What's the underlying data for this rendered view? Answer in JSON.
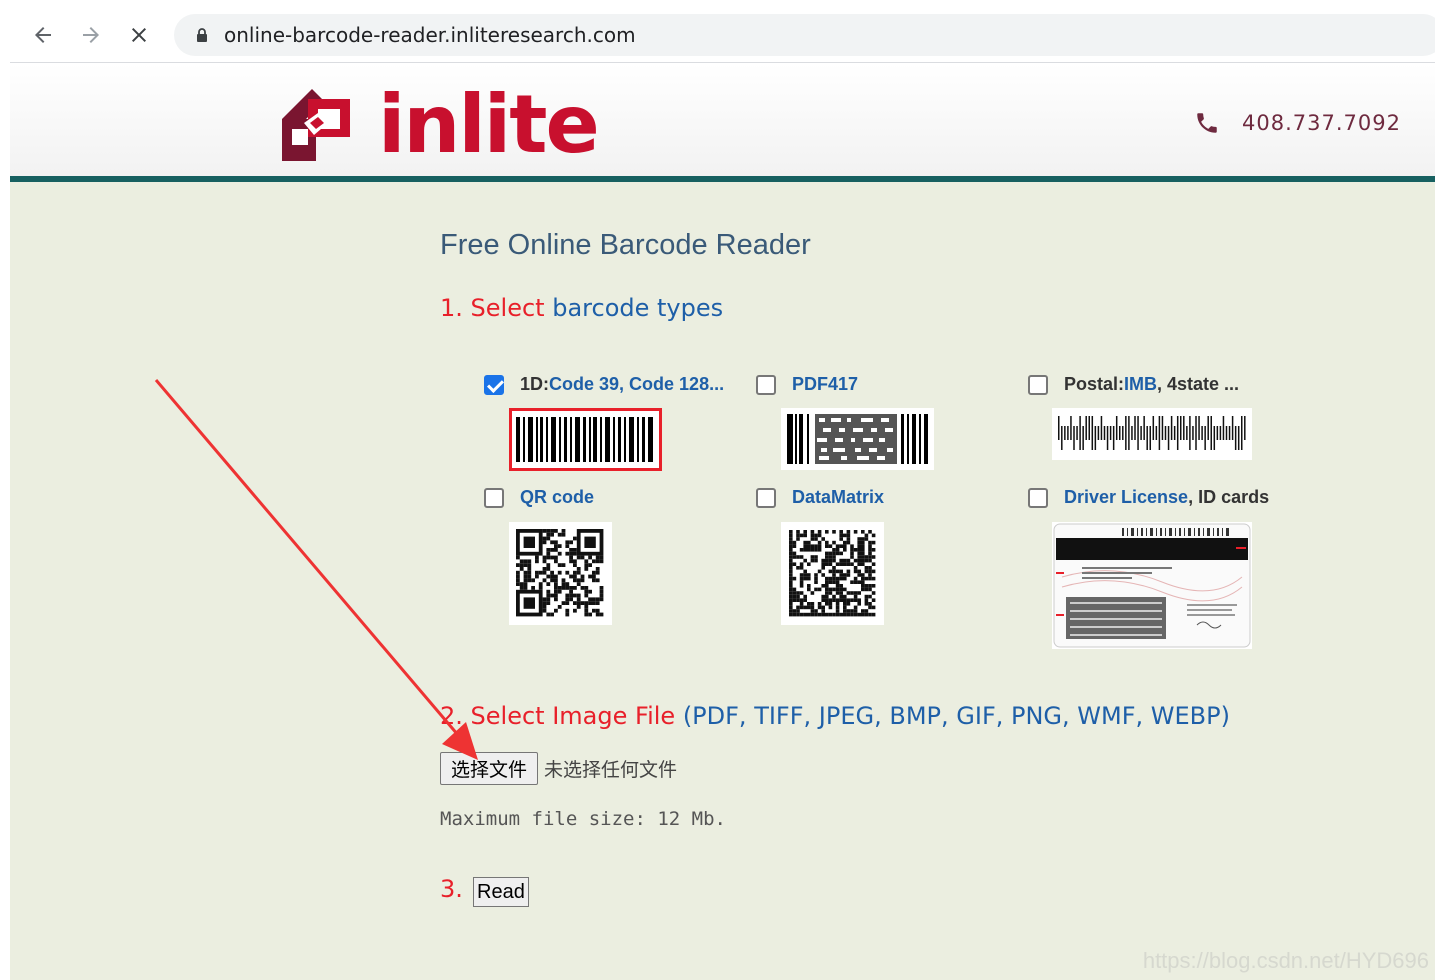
{
  "browser": {
    "url": "online-barcode-reader.inliteresearch.com",
    "back_icon": "arrow-left-icon",
    "forward_icon": "arrow-right-icon",
    "stop_icon": "close-icon"
  },
  "header": {
    "logo_text": "inlite",
    "phone": "408.737.7092"
  },
  "main": {
    "title": "Free Online Barcode Reader",
    "step1": {
      "number": "1.",
      "select": "Select",
      "rest": "barcode types"
    },
    "barcode_types": [
      {
        "checked": true,
        "prefix": "1D: ",
        "link": "Code 39, Code 128...",
        "suffix": ""
      },
      {
        "checked": false,
        "prefix": "",
        "link": "PDF417",
        "suffix": ""
      },
      {
        "checked": false,
        "prefix": "Postal: ",
        "link": "IMB",
        "suffix": ", 4state ..."
      },
      {
        "checked": false,
        "prefix": "",
        "link": "QR code",
        "suffix": ""
      },
      {
        "checked": false,
        "prefix": "",
        "link": "DataMatrix",
        "suffix": ""
      },
      {
        "checked": false,
        "prefix": "",
        "link": "Driver License",
        "suffix": ", ID cards"
      }
    ],
    "step2": {
      "number": "2.",
      "label": "Select Image File",
      "formats": "(PDF, TIFF, JPEG, BMP, GIF, PNG, WMF, WEBP)",
      "file_button": "选择文件",
      "file_status": "未选择任何文件",
      "max_size": "Maximum file size: 12 Mb."
    },
    "step3": {
      "number": "3.",
      "read_button": "Read"
    }
  },
  "colors": {
    "accent_red": "#e8202a",
    "link_blue": "#1e5fa8",
    "header_bar": "#176060",
    "bg": "#ebeee0"
  },
  "watermark": "https://blog.csdn.net/HYD696"
}
